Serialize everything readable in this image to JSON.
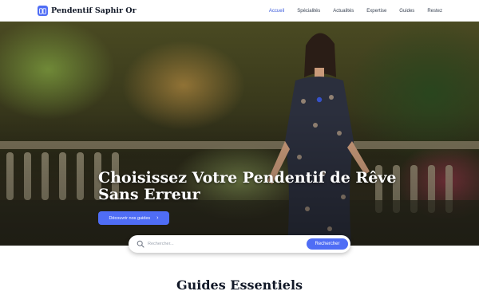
{
  "brand": {
    "name": "Pendentif Saphir Or",
    "icon": "book-icon",
    "accent": "#4f6df5"
  },
  "nav": {
    "items": [
      {
        "label": "Accueil",
        "active": true
      },
      {
        "label": "Spécialités",
        "active": false
      },
      {
        "label": "Actualités",
        "active": false
      },
      {
        "label": "Expertise",
        "active": false
      },
      {
        "label": "Guides",
        "active": false
      },
      {
        "label": "Restez",
        "active": false
      }
    ]
  },
  "hero": {
    "title": "Choisissez Votre Pendentif de Rêve Sans Erreur",
    "button_label": "Découvrir nos guides",
    "button_icon": "chevron-right-icon"
  },
  "search": {
    "placeholder": "Rechercher...",
    "value": "",
    "button_label": "Rechercher",
    "icon": "search-icon"
  },
  "section": {
    "title": "Guides Essentiels"
  }
}
